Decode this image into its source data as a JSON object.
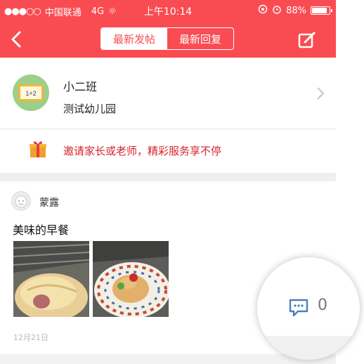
{
  "status_bar": {
    "carrier": "中国联通",
    "network": "4G",
    "time": "上午10:14",
    "battery": "88%",
    "battery_level": 0.88
  },
  "nav": {
    "tabs": [
      {
        "label": "最新发帖",
        "active": true
      },
      {
        "label": "最新回复",
        "active": false
      }
    ]
  },
  "class_info": {
    "avatar_text": "1+2",
    "class_name": "小二班",
    "school": "测试幼儿园"
  },
  "invite": {
    "text": "邀请家长或老师，精彩服务享不停"
  },
  "post": {
    "author": "蒙露",
    "title": "美味的早餐",
    "date": "12月21日",
    "comment_count": "0"
  },
  "colors": {
    "brand": "#f94c52",
    "invite_text": "#d6232a"
  },
  "icons": [
    "back-arrow-icon",
    "compose-icon",
    "chevron-right-icon",
    "gift-icon",
    "comment-icon"
  ]
}
